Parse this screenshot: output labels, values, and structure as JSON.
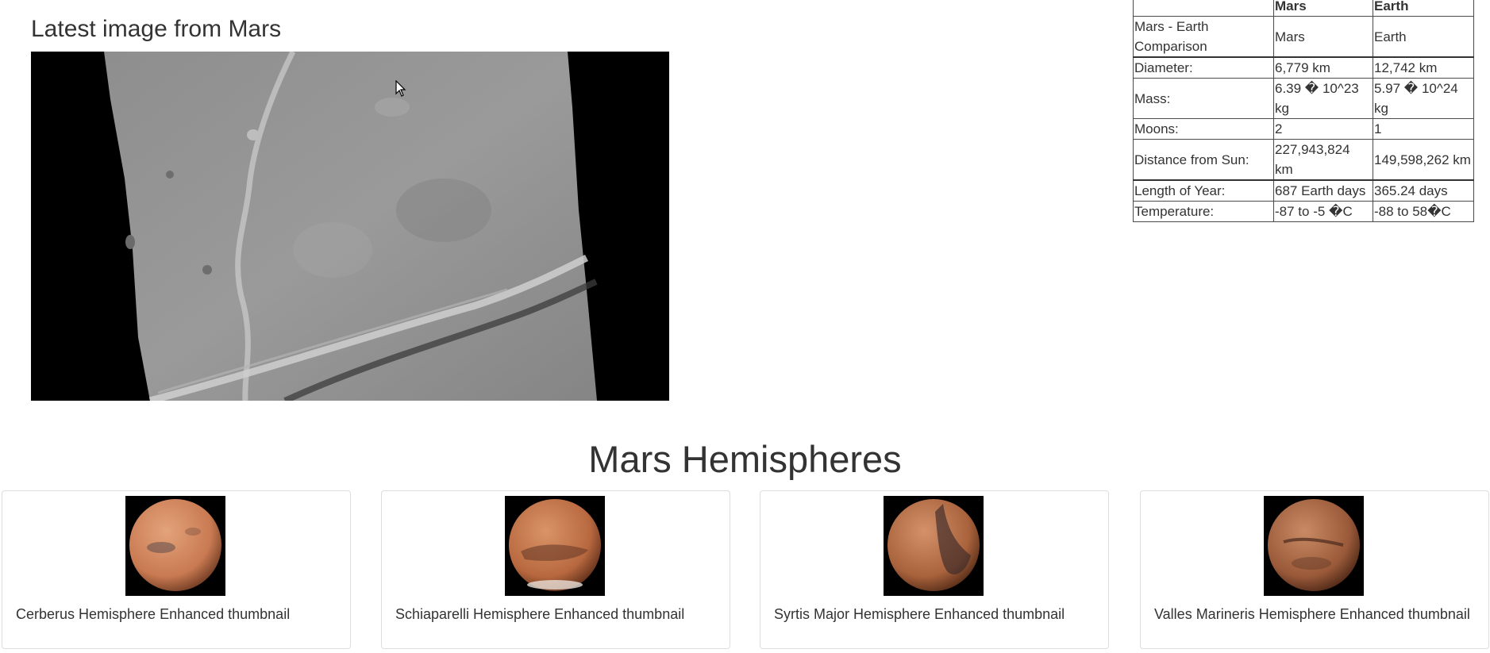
{
  "latest": {
    "title": "Latest image from Mars"
  },
  "facts_table": {
    "headers": [
      "",
      "Mars",
      "Earth"
    ],
    "rows": [
      [
        "Mars - Earth Comparison",
        "Mars",
        "Earth"
      ],
      [
        "Diameter:",
        "6,779 km",
        "12,742 km"
      ],
      [
        "Mass:",
        "6.39 � 10^23 kg",
        "5.97 � 10^24 kg"
      ],
      [
        "Moons:",
        "2",
        "1"
      ],
      [
        "Distance from Sun:",
        "227,943,824 km",
        "149,598,262 km"
      ],
      [
        "Length of Year:",
        "687 Earth days",
        "365.24 days"
      ],
      [
        "Temperature:",
        "-87 to -5 �C",
        "-88 to 58�C"
      ]
    ]
  },
  "hemispheres": {
    "title": "Mars Hemispheres",
    "cards": [
      {
        "caption": "Cerberus Hemisphere Enhanced thumbnail",
        "color": "#c97a52"
      },
      {
        "caption": "Schiaparelli Hemisphere Enhanced thumbnail",
        "color": "#b8683f"
      },
      {
        "caption": "Syrtis Major Hemisphere Enhanced thumbnail",
        "color": "#a8623c"
      },
      {
        "caption": "Valles Marineris Hemisphere Enhanced thumbnail",
        "color": "#9a5a3a"
      }
    ]
  },
  "colors": {
    "text": "#333333",
    "border": "#dddddd",
    "table_border": "#4a4a4a"
  }
}
